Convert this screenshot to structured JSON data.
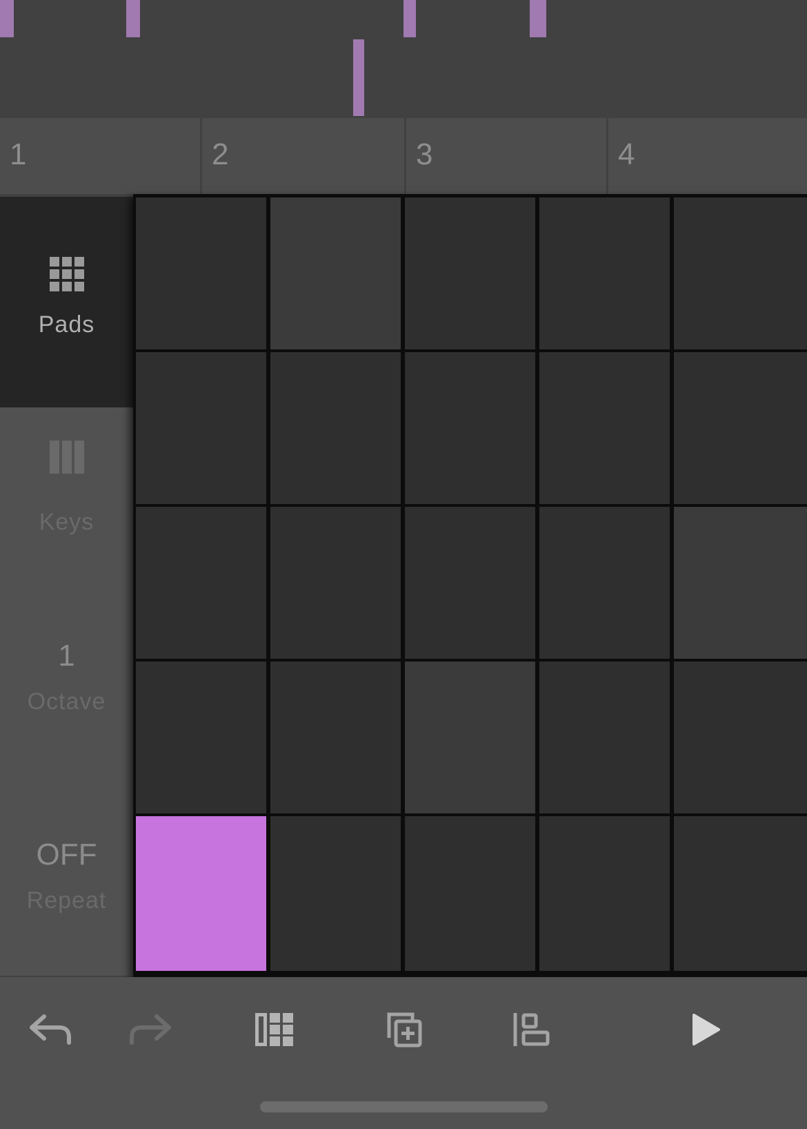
{
  "ruler": {
    "bars": [
      "1",
      "2",
      "3",
      "4"
    ]
  },
  "side_panel": {
    "pads": {
      "label": "Pads",
      "icon": "grid-icon",
      "selected": true
    },
    "keys": {
      "label": "Keys",
      "icon": "keys-icon",
      "selected": false
    },
    "octave": {
      "value": "1",
      "label": "Octave"
    },
    "repeat": {
      "value": "OFF",
      "label": "Repeat"
    }
  },
  "pads": {
    "rows": 5,
    "columns": 5,
    "active_color": "#c874de",
    "active_pad": {
      "row": 5,
      "column": 1
    },
    "lit_pads": [
      {
        "row": 1,
        "column": 2
      },
      {
        "row": 3,
        "column": 5
      },
      {
        "row": 4,
        "column": 3
      }
    ]
  },
  "toolbar": {
    "buttons": [
      {
        "name": "undo",
        "icon": "undo-icon",
        "enabled": true
      },
      {
        "name": "redo",
        "icon": "redo-icon",
        "enabled": false
      },
      {
        "name": "view-layout",
        "icon": "layout-icon",
        "enabled": true
      },
      {
        "name": "duplicate",
        "icon": "duplicate-icon",
        "enabled": true
      },
      {
        "name": "align",
        "icon": "align-icon",
        "enabled": true
      },
      {
        "name": "play",
        "icon": "play-icon",
        "enabled": true
      }
    ]
  },
  "colors": {
    "note": "#a07ab0",
    "background": "#414141",
    "pad": "#2f2f2f",
    "pad_lit": "#3b3b3b",
    "active_pad": "#c874de"
  }
}
